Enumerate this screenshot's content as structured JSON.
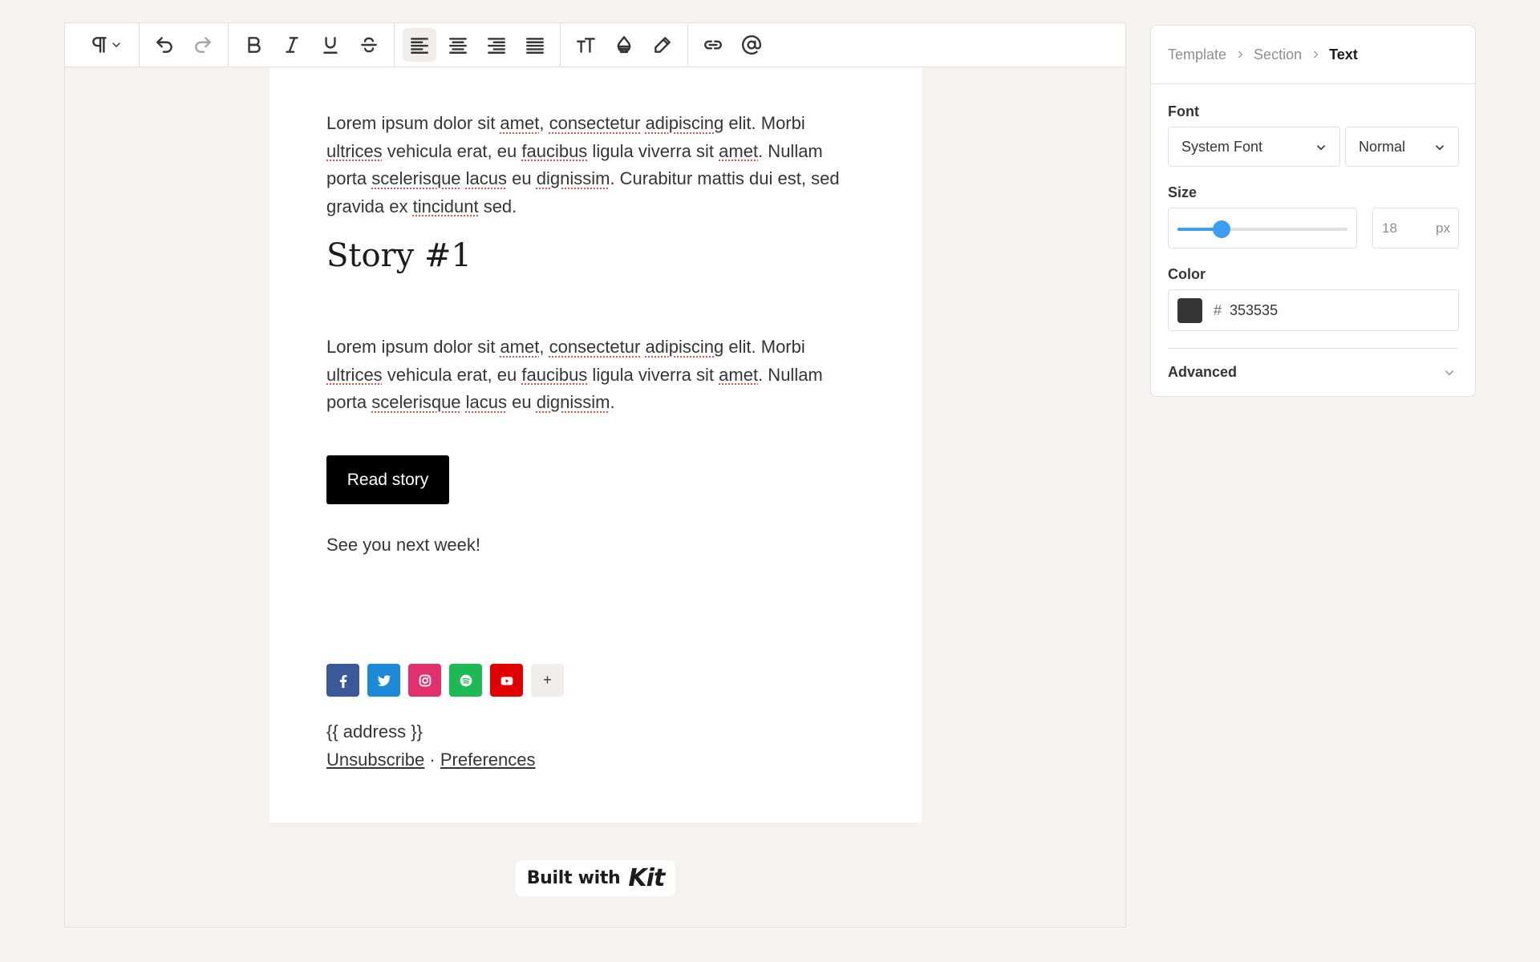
{
  "toolbar": {
    "paragraph_icon": "¶",
    "buttons": [
      "paragraph-style",
      "undo",
      "redo",
      "bold",
      "italic",
      "underline",
      "strikethrough",
      "align-left",
      "align-center",
      "align-right",
      "align-justify",
      "font-size",
      "text-color",
      "highlight",
      "link",
      "mention"
    ]
  },
  "email": {
    "paragraph1": "Lorem ipsum dolor sit amet, consectetur adipiscing elit. Morbi ultrices vehicula erat, eu faucibus ligula viverra sit amet. Nullam porta scelerisque lacus eu dignissim. Curabitur mattis dui est, sed gravida ex tincidunt sed.",
    "heading": "Story #1",
    "paragraph2": "Lorem ipsum dolor sit amet, consectetur adipiscing elit. Morbi ultrices vehicula erat, eu faucibus ligula viverra sit amet. Nullam porta scelerisque lacus eu dignissim.",
    "cta_label": "Read story",
    "signoff": "See you next week!",
    "social": [
      {
        "name": "facebook",
        "color": "#3b5998"
      },
      {
        "name": "twitter",
        "color": "#1d8ad8"
      },
      {
        "name": "instagram",
        "color": "#e1306c"
      },
      {
        "name": "spotify",
        "color": "#1db954"
      },
      {
        "name": "youtube",
        "color": "#e00000"
      },
      {
        "name": "add",
        "label": "+",
        "color": "#efeeea"
      }
    ],
    "address": "{{ address }}",
    "unsubscribe": "Unsubscribe",
    "separator": "·",
    "preferences": "Preferences"
  },
  "badge": {
    "built_with": "Built with",
    "brand": "Kit"
  },
  "panel": {
    "breadcrumb": [
      "Template",
      "Section",
      "Text"
    ],
    "font_label": "Font",
    "font_family": "System Font",
    "font_weight": "Normal",
    "size_label": "Size",
    "size_value": "18",
    "size_unit": "px",
    "size_slider_fraction": 0.26,
    "color_label": "Color",
    "color_hash": "#",
    "color_value": "353535",
    "color_swatch": "#353535",
    "advanced_label": "Advanced"
  }
}
